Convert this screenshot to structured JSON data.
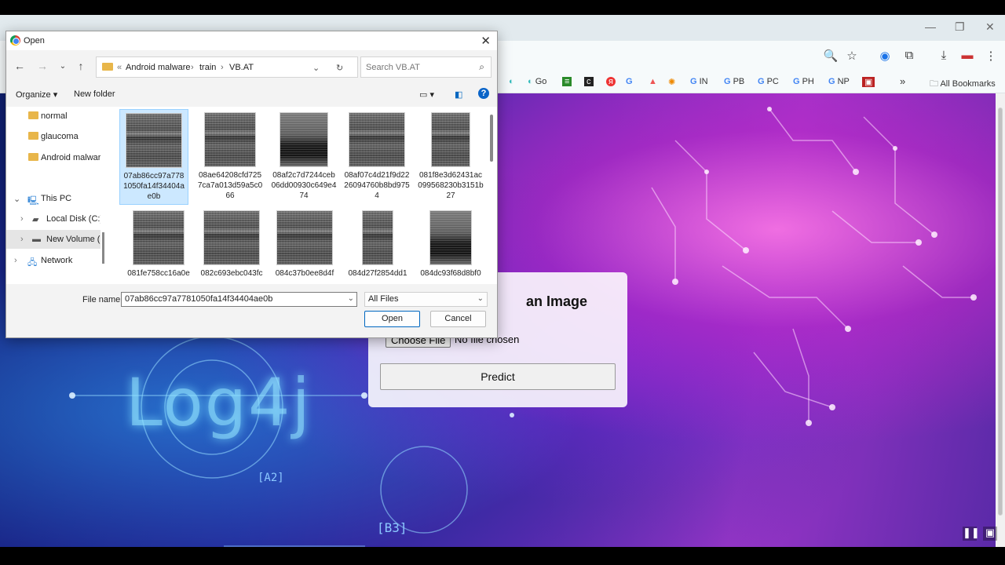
{
  "browser": {
    "bookmarks": [
      "Go",
      "G",
      "IN",
      "PB",
      "PC",
      "PH",
      "NP"
    ],
    "all_bookmarks": "All Bookmarks"
  },
  "page": {
    "upload_title": "an Image",
    "choose_file": "Choose File",
    "no_file": "No file chosen",
    "predict": "Predict",
    "logo_text": "Log4j",
    "tag_a2": "[A2]",
    "tag_b3": "[B3]"
  },
  "dialog": {
    "title": "Open",
    "breadcrumb": [
      "Android malware",
      "train",
      "VB.AT"
    ],
    "search_placeholder": "Search VB.AT",
    "organize": "Organize",
    "new_folder": "New folder",
    "nav_items": [
      {
        "label": "normal"
      },
      {
        "label": "glaucoma"
      },
      {
        "label": "Android malwar"
      },
      {
        "label": "This PC"
      },
      {
        "label": "Local Disk (C:)"
      },
      {
        "label": "New Volume (I"
      },
      {
        "label": "Network"
      }
    ],
    "files": [
      {
        "name": "07ab86cc97a7781050fa14f34404ae0b",
        "selected": true
      },
      {
        "name": "08ae64208cfd7257ca7a013d59a5c066"
      },
      {
        "name": "08af2c7d7244ceb06dd00930c649e474"
      },
      {
        "name": "08af07c4d21f9d2226094760b8bd9754"
      },
      {
        "name": "081f8e3d62431ac099568230b3151b27"
      },
      {
        "name": "081fe758cc16a0e"
      },
      {
        "name": "082c693ebc043fc"
      },
      {
        "name": "084c37b0ee8d4f"
      },
      {
        "name": "084d27f2854dd1"
      },
      {
        "name": "084dc93f68d8bf0"
      }
    ],
    "file_name_label": "File name:",
    "file_name_value": "07ab86cc97a7781050fa14f34404ae0b",
    "file_type": "All Files",
    "open_btn": "Open",
    "cancel_btn": "Cancel"
  },
  "colors": {
    "accent": "#0067c0",
    "folder": "#e8b64a",
    "selection": "#cce8ff"
  }
}
